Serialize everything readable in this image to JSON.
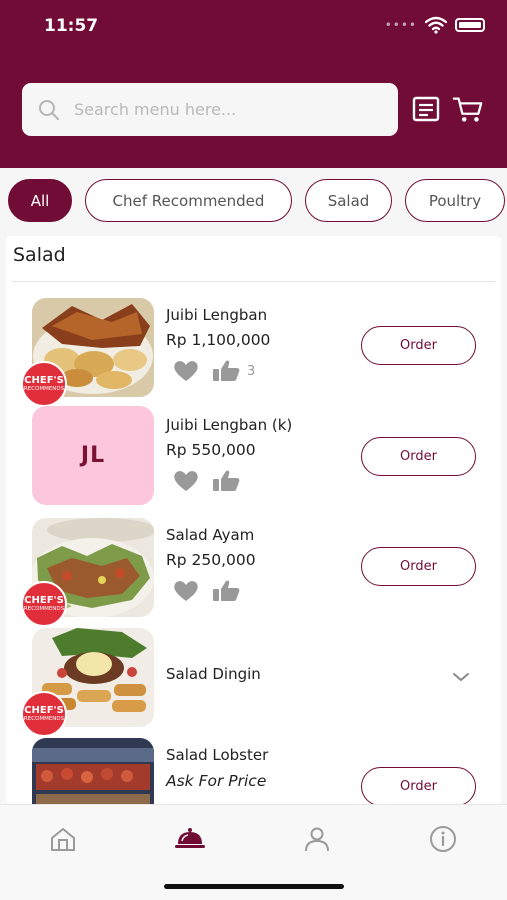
{
  "status_bar": {
    "time": "11:57"
  },
  "search": {
    "placeholder": "Search menu here..."
  },
  "colors": {
    "brand": "#700c35",
    "chip_active_bg": "#700c35",
    "badge": "#e02f3b",
    "initials_bg": "#fcc7da"
  },
  "categories": [
    {
      "label": "All",
      "active": true
    },
    {
      "label": "Chef Recommended",
      "active": false
    },
    {
      "label": "Salad",
      "active": false
    },
    {
      "label": "Poultry",
      "active": false
    }
  ],
  "section": {
    "title": "Salad"
  },
  "badge": {
    "line1": "CHEF'S",
    "line2": "RECOMMENDS"
  },
  "order_label": "Order",
  "items": [
    {
      "name": "Juibi Lengban",
      "price": "Rp 1,100,000",
      "likes": "3",
      "thumb": "photo",
      "chef": true
    },
    {
      "name": "Juibi Lengban (k)",
      "price": "Rp 550,000",
      "thumb_initials": "JL",
      "chef": false
    },
    {
      "name": "Salad Ayam",
      "price": "Rp 250,000",
      "thumb": "photo",
      "chef": true
    },
    {
      "name": "Salad Dingin",
      "thumb": "photo",
      "chef": true,
      "expandable": true
    },
    {
      "name": "Salad Lobster",
      "price": "Ask For Price",
      "thumb": "photo",
      "chef": false
    }
  ],
  "icons": {
    "search": "search-icon",
    "menu_list": "receipt-icon",
    "cart": "cart-icon",
    "heart": "heart-icon",
    "like": "thumbs-up-icon",
    "chevron": "chevron-down-icon",
    "tabs": [
      "home-icon",
      "cloche-icon",
      "user-icon",
      "info-icon"
    ]
  },
  "tabs": {
    "active_index": 1
  }
}
